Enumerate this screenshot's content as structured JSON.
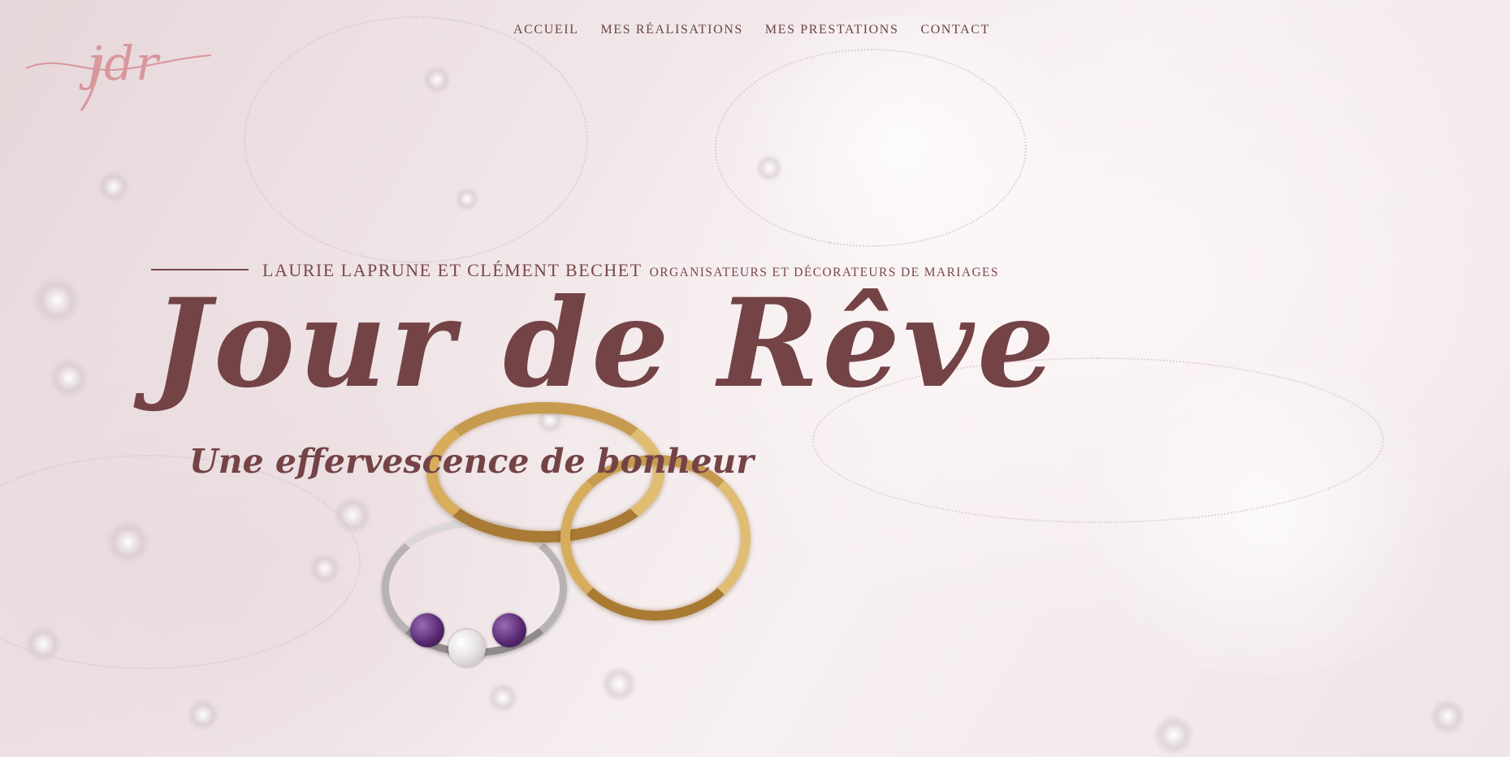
{
  "logo": {
    "text": "jdr",
    "color": "#d9969c"
  },
  "nav": {
    "items": [
      {
        "label": "ACCUEIL"
      },
      {
        "label": "MES RÉALISATIONS"
      },
      {
        "label": "MES PRESTATIONS"
      },
      {
        "label": "CONTACT"
      }
    ]
  },
  "hero": {
    "names": "LAURIE LAPRUNE ET CLÉMENT BECHET",
    "role": "ORGANISATEURS ET DÉCORATEURS DE MARIAGES",
    "title": "Jour de Rêve",
    "subtitle": "Une effervescence de bonheur",
    "background": "wedding-rings-on-lace-dress-photo"
  },
  "colors": {
    "text": "#744346",
    "nav": "#6b4448",
    "accent": "#d9969c"
  }
}
